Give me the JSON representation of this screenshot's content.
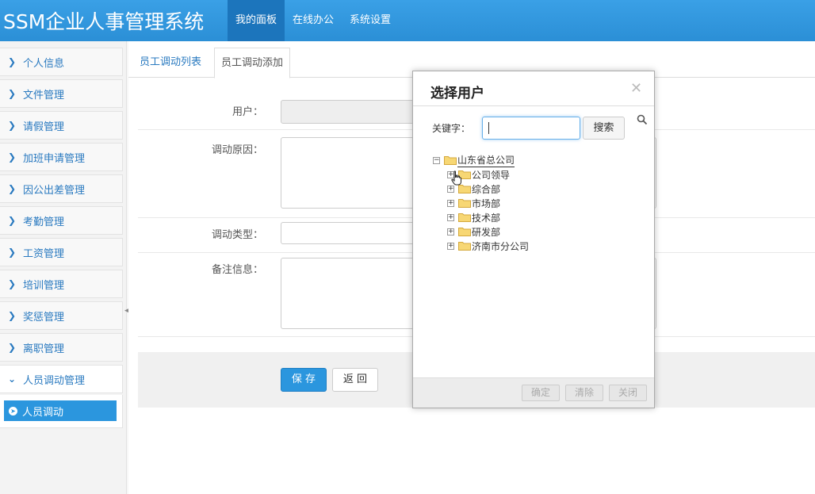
{
  "header": {
    "app_title": "SSM企业人事管理系统",
    "nav": [
      "我的面板",
      "在线办公",
      "系统设置"
    ],
    "accent_color": "#2b8fd6"
  },
  "sidebar": {
    "items": [
      {
        "label": "个人信息",
        "icon": "chevron-right-icon"
      },
      {
        "label": "文件管理",
        "icon": "chevron-right-icon"
      },
      {
        "label": "请假管理",
        "icon": "chevron-right-icon"
      },
      {
        "label": "加班申请管理",
        "icon": "chevron-right-icon"
      },
      {
        "label": "因公出差管理",
        "icon": "chevron-right-icon"
      },
      {
        "label": "考勤管理",
        "icon": "chevron-right-icon"
      },
      {
        "label": "工资管理",
        "icon": "chevron-right-icon"
      },
      {
        "label": "培训管理",
        "icon": "chevron-right-icon"
      },
      {
        "label": "奖惩管理",
        "icon": "chevron-right-icon"
      },
      {
        "label": "离职管理",
        "icon": "chevron-right-icon"
      },
      {
        "label": "人员调动管理",
        "icon": "chevron-down-icon"
      }
    ],
    "sub_items": [
      {
        "label": "人员调动",
        "icon": "circle-arrow-right-icon"
      }
    ]
  },
  "tabs": [
    {
      "label": "员工调动列表",
      "active": false
    },
    {
      "label": "员工调动添加",
      "active": true
    }
  ],
  "form": {
    "user_label": "用户：",
    "reason_label": "调动原因：",
    "type_label": "调动类型：",
    "remark_label": "备注信息：",
    "save_label": "保 存",
    "back_label": "返 回"
  },
  "dialog": {
    "title": "选择用户",
    "close_icon": "close-icon",
    "keyword_label": "关键字：",
    "keyword_value": "",
    "search_button": "搜索",
    "tree": {
      "root": "山东省总公司",
      "children": [
        "公司领导",
        "综合部",
        "市场部",
        "技术部",
        "研发部",
        "济南市分公司"
      ]
    },
    "footer_buttons": [
      "确定",
      "清除",
      "关闭"
    ]
  }
}
